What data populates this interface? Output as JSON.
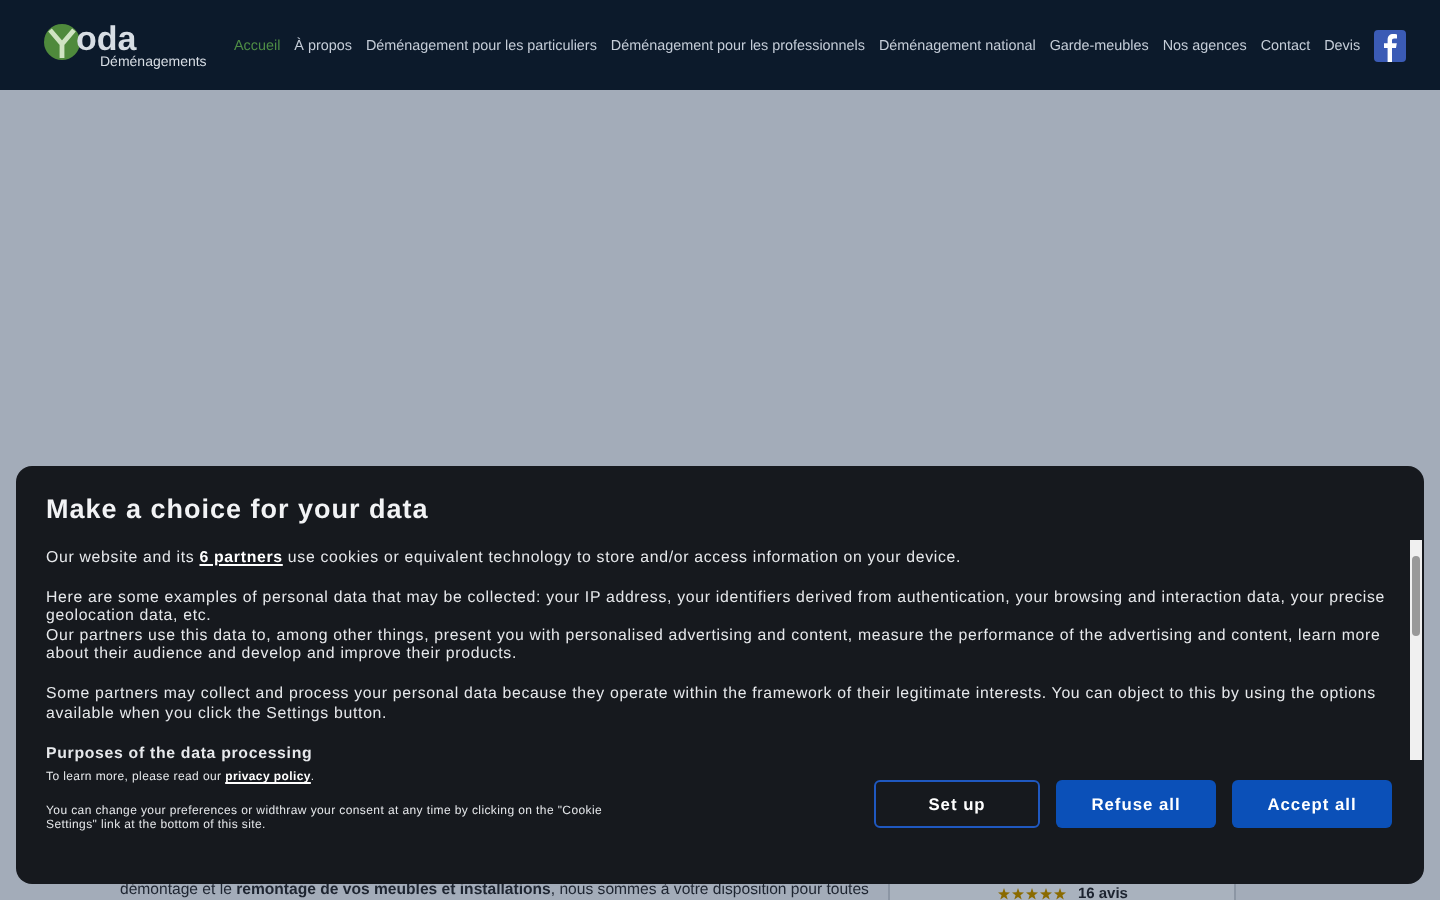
{
  "header": {
    "logo": {
      "name": "oda",
      "tagline": "Déménagements"
    },
    "nav": [
      {
        "label": "Accueil",
        "selected": true
      },
      {
        "label": "À propos",
        "selected": false
      },
      {
        "label": "Déménagement pour les particuliers",
        "selected": false
      },
      {
        "label": "Déménagement pour les professionnels",
        "selected": false
      },
      {
        "label": "Déménagement national",
        "selected": false
      },
      {
        "label": "Garde-meubles",
        "selected": false
      },
      {
        "label": "Nos agences",
        "selected": false
      },
      {
        "label": "Contact",
        "selected": false
      },
      {
        "label": "Devis",
        "selected": false
      }
    ]
  },
  "page": {
    "paragraph": "démontage et le **remontage de vos meubles et installations**, nous sommes à votre disposition pour toutes",
    "review": {
      "stars": 5,
      "count": "16 avis"
    }
  },
  "consent": {
    "title": "Make a choice for your data",
    "intro_before": "Our website and its",
    "partners_link": "6 partners",
    "intro_after": "use cookies or equivalent technology to store and/or access information on your device.",
    "paragraphs": [
      "Here are some examples of personal data that may be collected: your IP address, your identifiers derived from authentication, your browsing and interaction data, your precise geolocation data, etc.",
      "Our partners use this data to, among other things, present you with personalised advertising and content, measure the performance of the advertising and content, learn more about their audience and develop and improve their products.",
      "Some partners may collect and process your personal data because they operate within the framework of their legitimate interests. You can object to this by using the options available when you click the Settings button."
    ],
    "section_title": "Purposes of the data processing",
    "learn_before": "To learn more, please read our",
    "privacy_link": "privacy policy",
    "learn_after": ".",
    "note": "You can change your preferences or widthraw your consent at any time by clicking on the \"Cookie Settings\" link at the bottom of this site.",
    "buttons": [
      {
        "label": "Set up",
        "kind": "outline"
      },
      {
        "label": "Refuse all",
        "kind": "filled"
      },
      {
        "label": "Accept all",
        "kind": "filled"
      }
    ]
  }
}
